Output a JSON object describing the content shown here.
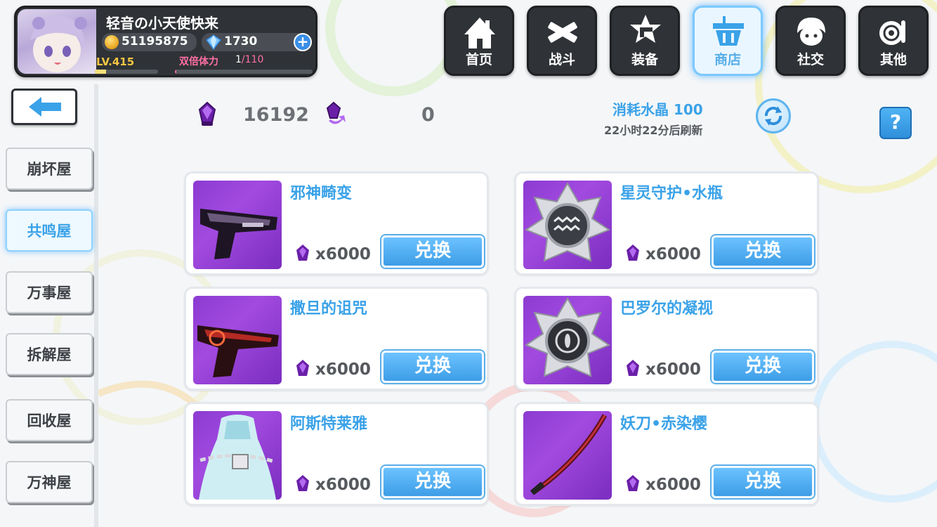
{
  "player": {
    "name": "轻音の小天使快来",
    "coins": "51195875",
    "gems": "1730",
    "level": "LV.415",
    "xp_fraction": 0.18,
    "stamina_label": "双倍体力",
    "stamina_current": "1",
    "stamina_max": "/110",
    "stamina_fraction": 0.01
  },
  "nav": {
    "items": [
      {
        "label": "首页",
        "icon": "house-icon"
      },
      {
        "label": "战斗",
        "icon": "crossed-swords-icon"
      },
      {
        "label": "装备",
        "icon": "gun-badge-icon"
      },
      {
        "label": "商店",
        "icon": "shopping-basket-icon"
      },
      {
        "label": "社交",
        "icon": "character-face-icon"
      },
      {
        "label": "其他",
        "icon": "snail-icon"
      }
    ],
    "active": "商店"
  },
  "sidebar": {
    "back_icon": "back-arrow-icon",
    "items": [
      {
        "label": "崩坏屋"
      },
      {
        "label": "共鸣屋"
      },
      {
        "label": "万事屋"
      },
      {
        "label": "拆解屋"
      },
      {
        "label": "回收屋"
      },
      {
        "label": "万神屋"
      }
    ],
    "active": "共鸣屋"
  },
  "currency": {
    "crystal_amount": "16192",
    "refresh_token_amount": "0",
    "refresh_cost": "消耗水晶 100",
    "refresh_time": "22小时22分后刷新",
    "help_label": "?"
  },
  "shop_items": [
    {
      "name": "邪神畸变",
      "price": "x6000",
      "button": "兑换",
      "image": "dark-pistol"
    },
    {
      "name": "星灵守护•水瓶",
      "price": "x6000",
      "button": "兑换",
      "image": "aquarius-badge"
    },
    {
      "name": "撒旦的诅咒",
      "price": "x6000",
      "button": "兑换",
      "image": "red-pistol"
    },
    {
      "name": "巴罗尔的凝视",
      "price": "x6000",
      "button": "兑换",
      "image": "eye-badge"
    },
    {
      "name": "阿斯特莱雅",
      "price": "x6000",
      "button": "兑换",
      "image": "chained-dress"
    },
    {
      "name": "妖刀•赤染樱",
      "price": "x6000",
      "button": "兑换",
      "image": "katana"
    }
  ],
  "colors": {
    "accent": "#3aa2e8",
    "panel_dark": "#2f3236",
    "item_bg": "#9b45dc",
    "coin": "#f4c542",
    "stamina": "#ff6fa3"
  }
}
